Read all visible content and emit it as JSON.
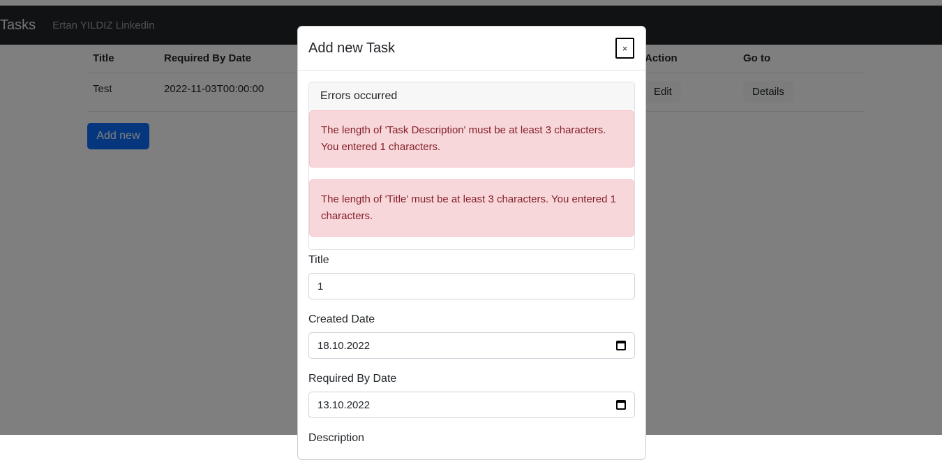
{
  "navbar": {
    "brand": "Tasks",
    "link": "Ertan YILDIZ Linkedin"
  },
  "table": {
    "headers": [
      "Title",
      "Required By Date",
      "Action",
      "Go to"
    ],
    "rows": [
      {
        "title": "Test",
        "required_by_date": "2022-11-03T00:00:00",
        "action": "Edit",
        "goto": "Details"
      }
    ]
  },
  "add_new_label": "Add new",
  "modal": {
    "title": "Add new Task",
    "close_label": "×",
    "errors_header": "Errors occurred",
    "errors": [
      "The length of 'Task Description' must be at least 3 characters. You entered 1 characters.",
      "The length of 'Title' must be at least 3 characters. You entered 1 characters."
    ],
    "fields": {
      "title_label": "Title",
      "title_value": "1",
      "created_label": "Created Date",
      "created_value": "18.10.2022",
      "required_label": "Required By Date",
      "required_value": "13.10.2022",
      "next_label_partial": "Description"
    }
  },
  "colors": {
    "primary": "#0d6efd",
    "alert_bg": "#f8d7da",
    "alert_text": "#842029",
    "navbar": "#212529"
  },
  "icons": {
    "calendar": "calendar-icon",
    "close": "close-icon"
  }
}
